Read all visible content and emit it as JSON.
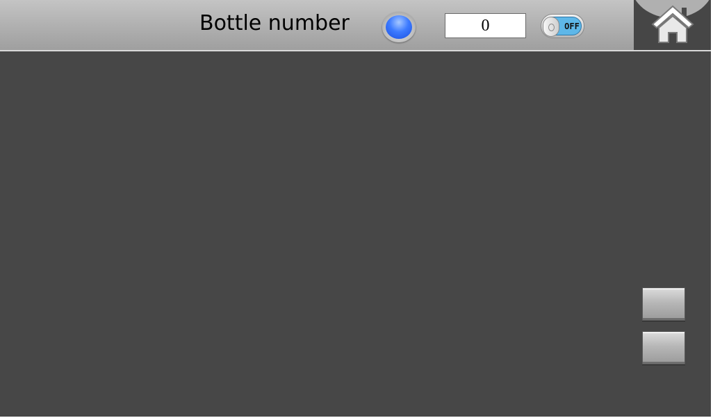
{
  "header": {
    "title": "Bottle number",
    "counter_value": "0",
    "switch_label": "OFF"
  },
  "icons": {
    "indicator": "status-lamp-icon",
    "home": "home-icon"
  },
  "colors": {
    "background": "#474747",
    "header": "#b1b1b1",
    "lamp": "#3d7bff",
    "switch_track": "#5eb7e8"
  }
}
